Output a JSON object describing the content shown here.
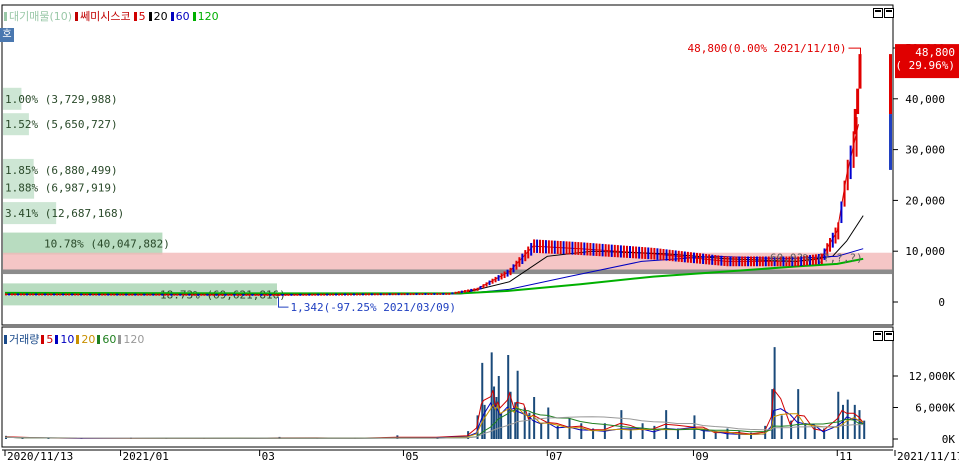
{
  "price_legend": {
    "items": [
      {
        "label": "대기매물(10)",
        "color": "#9ac8a8"
      },
      {
        "label": "쎄미시스코",
        "color": "#c00000"
      },
      {
        "label": "5",
        "color": "#d00000"
      },
      {
        "label": "20",
        "color": "#000000"
      },
      {
        "label": "60",
        "color": "#0000c0"
      },
      {
        "label": "120",
        "color": "#00b000"
      }
    ]
  },
  "volume_legend": {
    "items": [
      {
        "label": "거래량",
        "color": "#1a4a8a"
      },
      {
        "label": "5",
        "color": "#d00000"
      },
      {
        "label": "10",
        "color": "#0000c0"
      },
      {
        "label": "20",
        "color": "#c89000"
      },
      {
        "label": "60",
        "color": "#208020"
      },
      {
        "label": "120",
        "color": "#999999"
      }
    ]
  },
  "side_button": "호",
  "chart_data": [
    {
      "type": "candlestick",
      "title": "쎄미시스코",
      "y_ticks": [
        "0",
        "10,000",
        "20,000",
        "30,000",
        "40,000",
        "50,000"
      ],
      "ylim": [
        -2000,
        51000
      ],
      "x_ticks": [
        "2020/11/13",
        "2021/01",
        "03",
        "05",
        "07",
        "09",
        "11",
        "2021/11/17"
      ],
      "x_range": [
        "2020-11-13",
        "2021-11-17"
      ],
      "current_price": {
        "value": "48,800",
        "change": "( 29.96%)",
        "color": "#e00000"
      },
      "high_annotation": "48,800(0.00% 2021/11/10)",
      "high_value": 48800,
      "high_date": "2021-11-10",
      "low_annotation": "1,342(-97.25% 2021/03/09)",
      "low_value": 1342,
      "low_date": "2021-03-09",
      "right_note": "60,0?% (?,?,?)",
      "volume_profile": [
        {
          "label": "1.00% (3,729,988)",
          "pct": 1.0,
          "price_mid": 40000
        },
        {
          "label": "1.52% (5,650,727)",
          "pct": 1.52,
          "price_mid": 35000
        },
        {
          "label": "1.85% (6,880,499)",
          "pct": 1.85,
          "price_mid": 26000
        },
        {
          "label": "1.88% (6,987,919)",
          "pct": 1.88,
          "price_mid": 22500
        },
        {
          "label": "3.41% (12,687,168)",
          "pct": 3.41,
          "price_mid": 17500
        },
        {
          "label": "10.78% (40,047,882)",
          "pct": 10.78,
          "price_mid": 11500
        },
        {
          "label": "18.73% (69,621,816)",
          "pct": 18.73,
          "price_mid": 1500
        }
      ],
      "highlight_band": {
        "from": 6000,
        "to": 9700,
        "color": "#f2b8b8"
      },
      "gray_band": {
        "from": 5500,
        "to": 6400,
        "color": "#8c8c8c"
      },
      "series": [
        {
          "name": "5",
          "color": "#d00000",
          "points": [
            [
              "2020-11-13",
              1500
            ],
            [
              "2021-03-09",
              1400
            ],
            [
              "2021-05-20",
              1600
            ],
            [
              "2021-06-01",
              2500
            ],
            [
              "2021-06-15",
              6000
            ],
            [
              "2021-06-25",
              11000
            ],
            [
              "2021-07-15",
              10500
            ],
            [
              "2021-08-15",
              9500
            ],
            [
              "2021-09-15",
              8000
            ],
            [
              "2021-10-15",
              8000
            ],
            [
              "2021-10-25",
              8500
            ],
            [
              "2021-11-01",
              14000
            ],
            [
              "2021-11-05",
              25000
            ],
            [
              "2021-11-10",
              35000
            ]
          ]
        },
        {
          "name": "20",
          "color": "#000000",
          "points": [
            [
              "2020-11-13",
              1600
            ],
            [
              "2021-03-09",
              1500
            ],
            [
              "2021-05-25",
              1600
            ],
            [
              "2021-06-15",
              4000
            ],
            [
              "2021-07-01",
              9000
            ],
            [
              "2021-07-20",
              10000
            ],
            [
              "2021-08-20",
              9500
            ],
            [
              "2021-09-15",
              8500
            ],
            [
              "2021-10-15",
              8000
            ],
            [
              "2021-10-30",
              9000
            ],
            [
              "2021-11-05",
              12000
            ],
            [
              "2021-11-12",
              17000
            ]
          ]
        },
        {
          "name": "60",
          "color": "#0000c0",
          "points": [
            [
              "2020-11-13",
              1700
            ],
            [
              "2021-03-09",
              1600
            ],
            [
              "2021-05-25",
              1600
            ],
            [
              "2021-06-15",
              2500
            ],
            [
              "2021-07-10",
              5000
            ],
            [
              "2021-08-10",
              8000
            ],
            [
              "2021-09-10",
              9000
            ],
            [
              "2021-10-10",
              8500
            ],
            [
              "2021-11-01",
              9000
            ],
            [
              "2021-11-12",
              10500
            ]
          ]
        },
        {
          "name": "120",
          "color": "#00b000",
          "points": [
            [
              "2020-11-13",
              1800
            ],
            [
              "2021-03-09",
              1700
            ],
            [
              "2021-05-25",
              1700
            ],
            [
              "2021-06-15",
              2200
            ],
            [
              "2021-07-15",
              3500
            ],
            [
              "2021-08-15",
              5000
            ],
            [
              "2021-09-15",
              6000
            ],
            [
              "2021-10-15",
              7000
            ],
            [
              "2021-11-01",
              7500
            ],
            [
              "2021-11-12",
              8500
            ]
          ]
        }
      ]
    },
    {
      "type": "bar",
      "title": "거래량",
      "y_ticks": [
        "0K",
        "6,000K",
        "12,000K"
      ],
      "ylim": [
        0,
        18000
      ],
      "x_range": [
        "2020-11-13",
        "2021-11-17"
      ],
      "values_note": "daily volume in thousands (K), estimated from bar heights",
      "bars": [
        [
          "2020-11-13",
          600
        ],
        [
          "2020-11-20",
          300
        ],
        [
          "2020-12-01",
          250
        ],
        [
          "2020-12-15",
          200
        ],
        [
          "2021-01-05",
          300
        ],
        [
          "2021-01-20",
          200
        ],
        [
          "2021-02-05",
          250
        ],
        [
          "2021-02-20",
          200
        ],
        [
          "2021-03-09",
          400
        ],
        [
          "2021-03-25",
          200
        ],
        [
          "2021-04-10",
          250
        ],
        [
          "2021-04-28",
          700
        ],
        [
          "2021-05-15",
          300
        ],
        [
          "2021-05-28",
          1500
        ],
        [
          "2021-06-01",
          4500
        ],
        [
          "2021-06-03",
          14500
        ],
        [
          "2021-06-04",
          6500
        ],
        [
          "2021-06-07",
          16500
        ],
        [
          "2021-06-08",
          10000
        ],
        [
          "2021-06-09",
          8000
        ],
        [
          "2021-06-10",
          12000
        ],
        [
          "2021-06-11",
          5000
        ],
        [
          "2021-06-14",
          16000
        ],
        [
          "2021-06-15",
          9000
        ],
        [
          "2021-06-17",
          7000
        ],
        [
          "2021-06-18",
          13000
        ],
        [
          "2021-06-21",
          6000
        ],
        [
          "2021-06-23",
          5000
        ],
        [
          "2021-06-25",
          8000
        ],
        [
          "2021-06-28",
          3000
        ],
        [
          "2021-07-01",
          6000
        ],
        [
          "2021-07-05",
          2500
        ],
        [
          "2021-07-10",
          4000
        ],
        [
          "2021-07-15",
          3000
        ],
        [
          "2021-07-20",
          2000
        ],
        [
          "2021-07-25",
          3000
        ],
        [
          "2021-08-01",
          5500
        ],
        [
          "2021-08-05",
          2000
        ],
        [
          "2021-08-10",
          3000
        ],
        [
          "2021-08-15",
          2500
        ],
        [
          "2021-08-20",
          5500
        ],
        [
          "2021-08-25",
          2000
        ],
        [
          "2021-09-01",
          4500
        ],
        [
          "2021-09-05",
          2000
        ],
        [
          "2021-09-10",
          1500
        ],
        [
          "2021-09-15",
          2000
        ],
        [
          "2021-09-20",
          1500
        ],
        [
          "2021-09-25",
          1200
        ],
        [
          "2021-10-01",
          2500
        ],
        [
          "2021-10-04",
          9500
        ],
        [
          "2021-10-05",
          17500
        ],
        [
          "2021-10-08",
          4500
        ],
        [
          "2021-10-12",
          3500
        ],
        [
          "2021-10-15",
          9500
        ],
        [
          "2021-10-18",
          3000
        ],
        [
          "2021-10-22",
          2500
        ],
        [
          "2021-10-26",
          2000
        ],
        [
          "2021-11-01",
          9000
        ],
        [
          "2021-11-03",
          6500
        ],
        [
          "2021-11-05",
          7500
        ],
        [
          "2021-11-08",
          6500
        ],
        [
          "2021-11-10",
          5500
        ],
        [
          "2021-11-12",
          3500
        ]
      ],
      "series": [
        {
          "name": "5",
          "color": "#d00000"
        },
        {
          "name": "10",
          "color": "#0000c0"
        },
        {
          "name": "20",
          "color": "#c89000"
        },
        {
          "name": "60",
          "color": "#208020"
        },
        {
          "name": "120",
          "color": "#999999"
        }
      ]
    }
  ]
}
